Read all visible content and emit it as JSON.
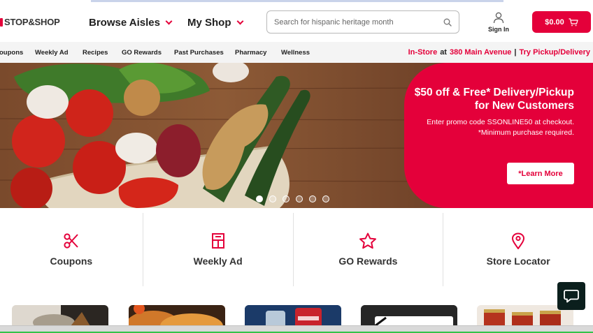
{
  "header": {
    "logo_text": "STOP&SHOP",
    "nav": [
      {
        "label": "Browse Aisles"
      },
      {
        "label": "My Shop"
      }
    ],
    "search_placeholder": "Search for hispanic heritage month",
    "signin_label": "Sign In",
    "cart_label": "$0.00"
  },
  "subnav": {
    "links": [
      "oupons",
      "Weekly Ad",
      "Recipes",
      "GO Rewards",
      "Past Purchases",
      "Pharmacy",
      "Wellness"
    ],
    "store_mode": "In-Store",
    "at": "at",
    "store_address": "380 Main Avenue",
    "separator": "|",
    "pickup_link": "Try Pickup/Delivery"
  },
  "hero": {
    "title": "$50 off & Free* Delivery/Pickup for New Customers",
    "subtitle": "Enter promo code SSONLINE50 at checkout. *Minimum purchase required.",
    "cta": "*Learn More",
    "slides": 6,
    "active_slide": 1
  },
  "features": [
    {
      "label": "Coupons",
      "icon": "scissors-icon"
    },
    {
      "label": "Weekly Ad",
      "icon": "weekly-ad-icon"
    },
    {
      "label": "GO Rewards",
      "icon": "star-icon"
    },
    {
      "label": "Store Locator",
      "icon": "location-pin-icon"
    }
  ],
  "colors": {
    "brand_red": "#e4003a",
    "chat_bg": "#0b1f1d"
  }
}
